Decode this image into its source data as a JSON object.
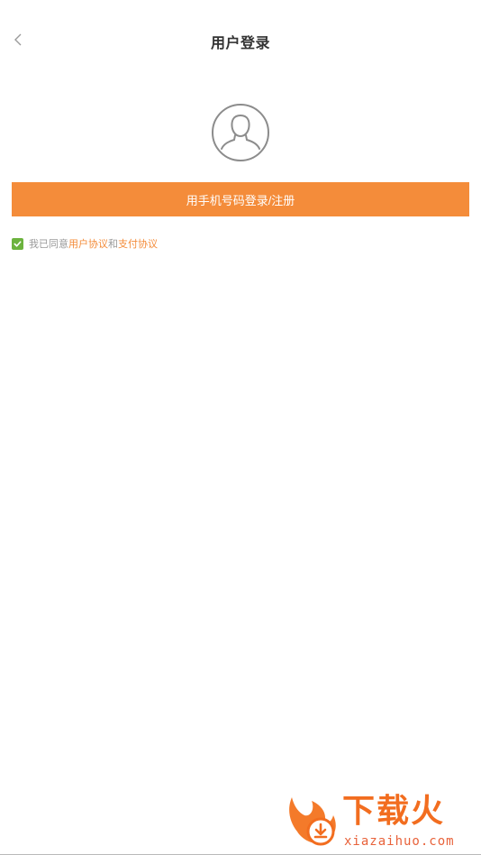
{
  "header": {
    "title": "用户登录",
    "back_icon": "chevron-left-icon"
  },
  "avatar": {
    "icon": "user-silhouette-icon"
  },
  "login": {
    "button_label": "用手机号码登录/注册",
    "button_color": "#f48c3a"
  },
  "agreement": {
    "checked": true,
    "prefix": "我已同意",
    "user_agreement": "用户协议",
    "connector": "和",
    "payment_agreement": "支付协议",
    "checkbox_color": "#6cb33e",
    "link_color": "#f48c3a"
  },
  "watermark": {
    "brand": "下载火",
    "site": "xiazaihuo.com"
  }
}
